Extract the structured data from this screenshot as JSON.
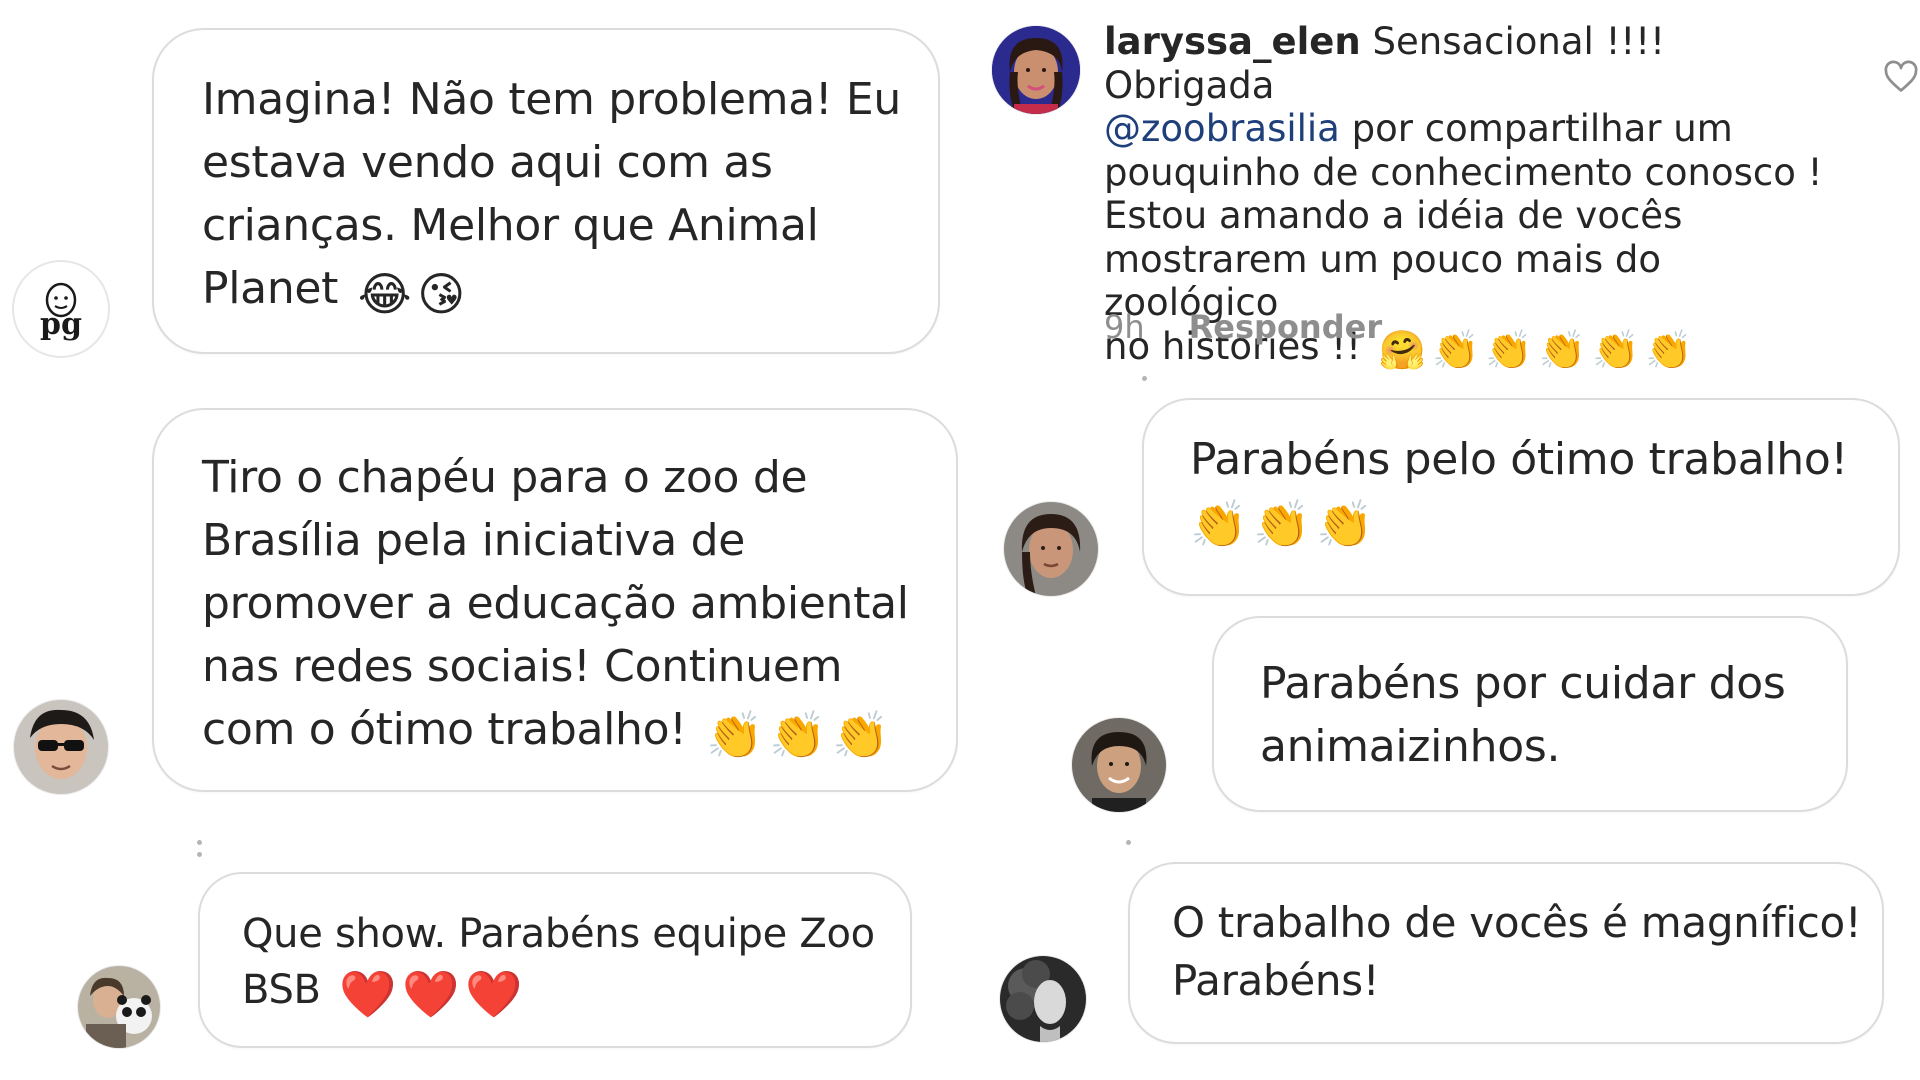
{
  "left_column": {
    "comment1": {
      "text": "Imagina! Não tem problema! Eu\nestava vendo aqui com as\ncrianças. Melhor que Animal\nPlanet",
      "emojis": [
        "😂",
        "😘"
      ],
      "avatar_text": "pg"
    },
    "comment2": {
      "text": "Tiro o chapéu para o zoo de\nBrasília pela iniciativa de\npromover a educação ambiental\nnas redes sociais! Continuem\ncom o ótimo trabalho!",
      "emojis": [
        "👏",
        "👏",
        "👏"
      ]
    },
    "comment3": {
      "text": "Que show. Parabéns equipe Zoo\nBSB",
      "emojis": [
        "❤️",
        "❤️",
        "❤️"
      ]
    }
  },
  "right_column": {
    "instagram_comment": {
      "username": "laryssa_elen",
      "text_before_mention": "Sensacional !!!! Obrigada",
      "mention": "@zoobrasilia",
      "text_after_mention": "por compartilhar um\npouquinho de conhecimento conosco !\nEstou amando a idéia de vocês\nmostrarem um pouco mais do zoológico\nno histories !!",
      "emojis": [
        "🤗",
        "👏",
        "👏",
        "👏",
        "👏",
        "👏"
      ],
      "time": "9h",
      "reply_label": "Responder"
    },
    "comment4": {
      "text": "Parabéns pelo ótimo trabalho!",
      "emojis": [
        "👏",
        "👏",
        "👏"
      ]
    },
    "comment5": {
      "text": "Parabéns por cuidar dos\nanimaizinhos."
    },
    "comment6": {
      "text": "O trabalho de vocês é magnífico!\nParabéns!"
    }
  },
  "icons": {
    "heart": "heart-outline-icon"
  },
  "colors": {
    "bubble_border": "#dcdcdc",
    "mention": "#1f3f7a",
    "meta_gray": "#8e8e8e"
  }
}
